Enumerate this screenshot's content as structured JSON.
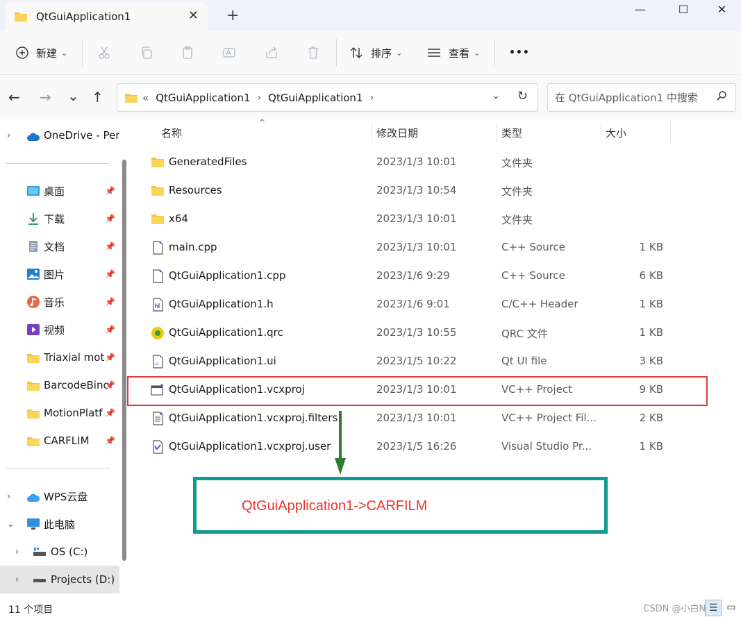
{
  "window": {
    "tab_title": "QtGuiApplication1",
    "tab_close": "✕",
    "new_tab": "+",
    "minimize": "—",
    "maximize": "☐",
    "close": "✕"
  },
  "toolbar": {
    "new_label": "新建",
    "sort_label": "排序",
    "view_label": "查看",
    "more": "•••"
  },
  "address": {
    "back": "←",
    "forward": "→",
    "recent": "⌄",
    "up": "↑",
    "overflow": "«",
    "crumbs": [
      "QtGuiApplication1",
      "QtGuiApplication1"
    ],
    "chevron": "›",
    "dropdown": "⌄",
    "refresh": "↻",
    "search_placeholder": "在 QtGuiApplication1 中搜索"
  },
  "sidebar": {
    "items": [
      {
        "label": "OneDrive - Per",
        "icon": "cloud-icon",
        "expander": "›"
      },
      {
        "label": "桌面",
        "icon": "desktop-icon",
        "pinned": true
      },
      {
        "label": "下载",
        "icon": "download-icon",
        "pinned": true
      },
      {
        "label": "文档",
        "icon": "document-icon",
        "pinned": true
      },
      {
        "label": "图片",
        "icon": "picture-icon",
        "pinned": true
      },
      {
        "label": "音乐",
        "icon": "music-icon",
        "pinned": true
      },
      {
        "label": "视频",
        "icon": "video-icon",
        "pinned": true
      },
      {
        "label": "Triaxial mot",
        "icon": "folder-icon",
        "pinned": true
      },
      {
        "label": "BarcodeBinc",
        "icon": "folder-icon",
        "pinned": true
      },
      {
        "label": "MotionPlatf",
        "icon": "folder-icon",
        "pinned": true
      },
      {
        "label": "CARFLIM",
        "icon": "folder-icon",
        "pinned": true
      },
      {
        "label": "WPS云盘",
        "icon": "cloud-icon",
        "expander": "›"
      },
      {
        "label": "此电脑",
        "icon": "pc-icon",
        "expander": "⌄"
      },
      {
        "label": "OS (C:)",
        "icon": "drive-icon",
        "expander": "›"
      },
      {
        "label": "Projects (D:)",
        "icon": "drive-icon",
        "expander": "›"
      }
    ],
    "pin_glyph": "📌"
  },
  "columns": {
    "name": "名称",
    "modified": "修改日期",
    "type": "类型",
    "size": "大小",
    "sort_indicator": "^"
  },
  "files": [
    {
      "name": "GeneratedFiles",
      "date": "2023/1/3 10:01",
      "type": "文件夹",
      "size": "",
      "icon": "folder-icon"
    },
    {
      "name": "Resources",
      "date": "2023/1/3 10:54",
      "type": "文件夹",
      "size": "",
      "icon": "folder-icon"
    },
    {
      "name": "x64",
      "date": "2023/1/3 10:01",
      "type": "文件夹",
      "size": "",
      "icon": "folder-icon"
    },
    {
      "name": "main.cpp",
      "date": "2023/1/3 10:01",
      "type": "C++ Source",
      "size": "1 KB",
      "icon": "cpp-file-icon"
    },
    {
      "name": "QtGuiApplication1.cpp",
      "date": "2023/1/6 9:29",
      "type": "C++ Source",
      "size": "6 KB",
      "icon": "cpp-file-icon"
    },
    {
      "name": "QtGuiApplication1.h",
      "date": "2023/1/6 9:01",
      "type": "C/C++ Header",
      "size": "1 KB",
      "icon": "header-file-icon"
    },
    {
      "name": "QtGuiApplication1.qrc",
      "date": "2023/1/3 10:55",
      "type": "QRC 文件",
      "size": "1 KB",
      "icon": "qrc-file-icon"
    },
    {
      "name": "QtGuiApplication1.ui",
      "date": "2023/1/5 10:22",
      "type": "Qt UI file",
      "size": "3 KB",
      "icon": "ui-file-icon"
    },
    {
      "name": "QtGuiApplication1.vcxproj",
      "date": "2023/1/3 10:01",
      "type": "VC++ Project",
      "size": "9 KB",
      "icon": "vcxproj-file-icon"
    },
    {
      "name": "QtGuiApplication1.vcxproj.filters",
      "date": "2023/1/3 10:01",
      "type": "VC++ Project Fil...",
      "size": "2 KB",
      "icon": "filters-file-icon"
    },
    {
      "name": "QtGuiApplication1.vcxproj.user",
      "date": "2023/1/5 16:26",
      "type": "Visual Studio Pr...",
      "size": "1 KB",
      "icon": "vs-file-icon"
    }
  ],
  "annotation": {
    "note": "QtGuiApplication1->CARFILM",
    "highlight_color": "#e03a3a",
    "box_color": "#0f9a93",
    "arrow_color": "#2e7d32"
  },
  "status": {
    "item_count": "11 个项目",
    "watermark": "CSDN @小白Nic",
    "details_view": "☰",
    "tiles_view": "▭"
  }
}
